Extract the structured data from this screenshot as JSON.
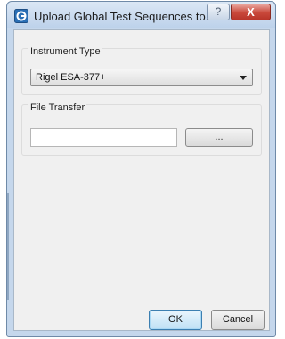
{
  "dialog": {
    "title": "Upload Global Test Sequences to...",
    "help_label": "?",
    "close_label": "X"
  },
  "instrument_group": {
    "label": "Instrument Type",
    "selected_value": "Rigel ESA-377+"
  },
  "file_group": {
    "label": "File Transfer",
    "path_value": "",
    "browse_label": "..."
  },
  "buttons": {
    "ok_label": "OK",
    "cancel_label": "Cancel"
  },
  "icons": {
    "app_icon": "app-icon",
    "dropdown_icon": "chevron-down-icon"
  },
  "colors": {
    "title_bar": "#c5d7ec",
    "close_button": "#c9483a",
    "client_background": "#f0f0f0"
  }
}
